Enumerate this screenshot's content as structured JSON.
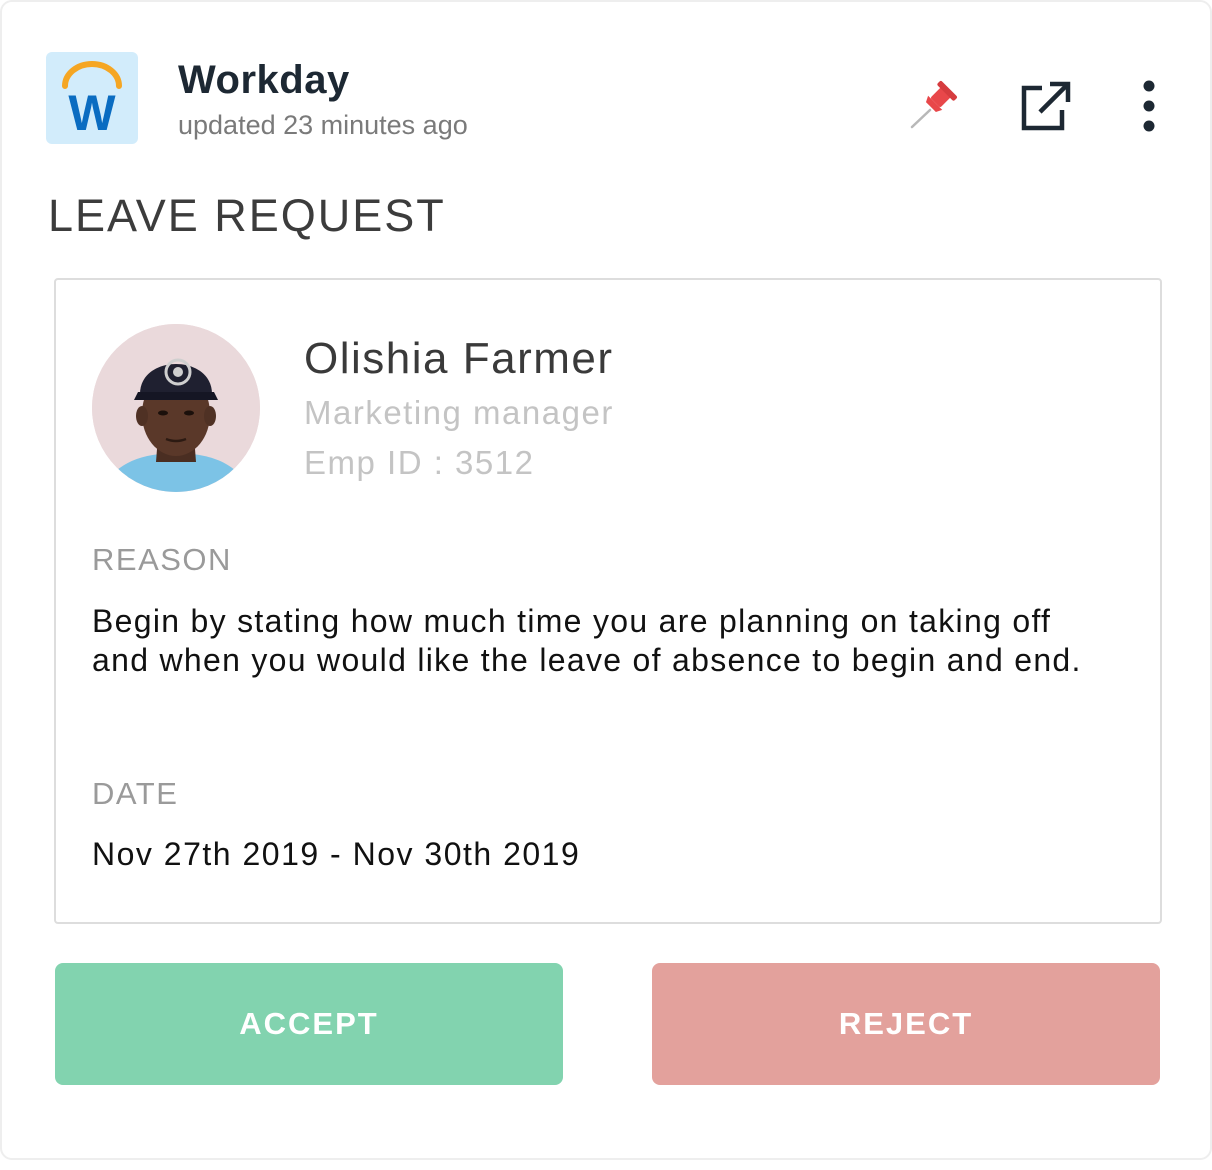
{
  "app": {
    "name": "Workday",
    "updated": "updated 23 minutes ago",
    "logo_letter": "W",
    "icons": [
      "pin-icon",
      "external-link-icon",
      "more-vertical-icon"
    ]
  },
  "section_title": "LEAVE REQUEST",
  "employee": {
    "name": "Olishia Farmer",
    "role": "Marketing manager",
    "emp_id": "Emp ID : 3512"
  },
  "reason": {
    "label": "REASON",
    "text": "Begin by stating how much time you are planning on taking off and when you would like the leave of absence to begin and end."
  },
  "date": {
    "label": "DATE",
    "value": "Nov 27th 2019 - Nov 30th 2019"
  },
  "actions": {
    "accept": "ACCEPT",
    "reject": "REJECT"
  },
  "colors": {
    "accept": "#82d3af",
    "reject": "#e3a19c",
    "logo_bg": "#d2ecfb",
    "logo_arc": "#f5a623",
    "logo_letter": "#0a6cc1",
    "pin": "#e8474a"
  }
}
